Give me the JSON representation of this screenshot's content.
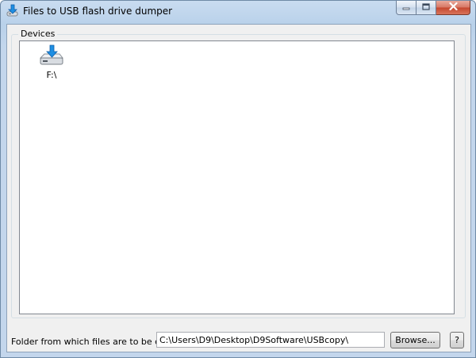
{
  "window": {
    "title": "Files to USB flash drive dumper",
    "icon": "usb-download-icon"
  },
  "caption_buttons": {
    "minimize": "minimize-icon",
    "maximize": "maximize-icon",
    "close": "close-icon"
  },
  "devices": {
    "group_label": "Devices",
    "items": [
      {
        "label": "F:\\",
        "icon": "drive-download-icon"
      }
    ]
  },
  "folder": {
    "label": "Folder from which files are to be copied:",
    "value": "C:\\Users\\D9\\Desktop\\D9Software\\USBcopy\\"
  },
  "buttons": {
    "browse_label": "Browse...",
    "help_label": "?"
  },
  "colors": {
    "arrow_blue": "#1e8fe3",
    "close_red": "#c5462e"
  }
}
